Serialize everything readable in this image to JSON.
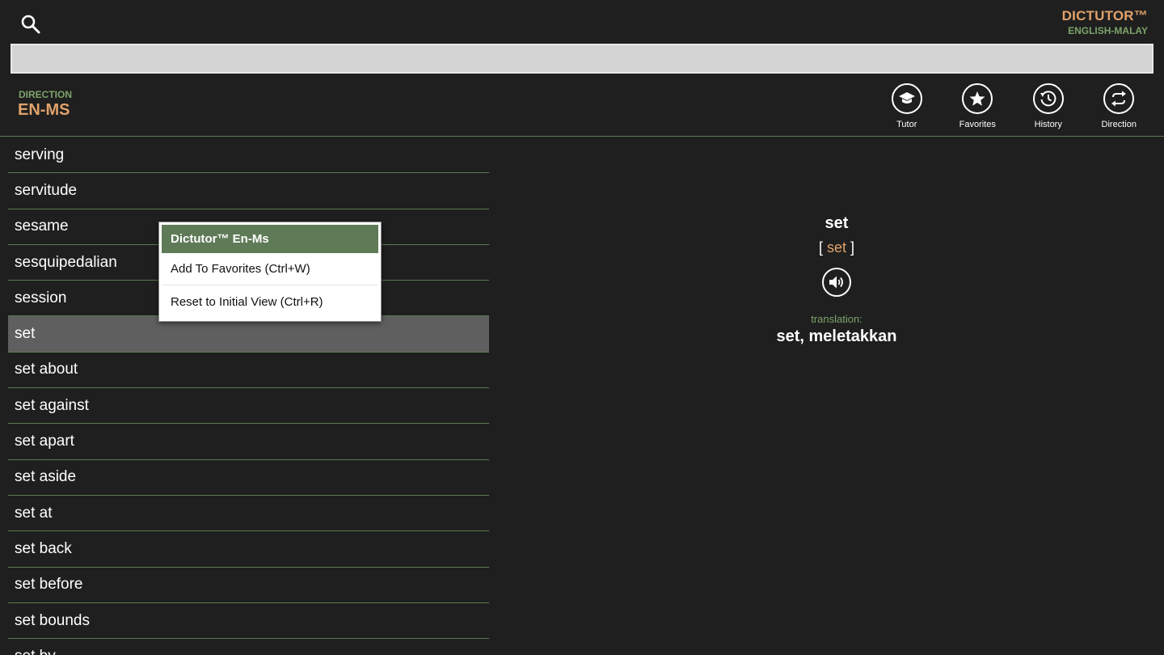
{
  "app": {
    "brand_title": "DICTUTOR™",
    "brand_subtitle": "ENGLISH-MALAY"
  },
  "search": {
    "value": "",
    "placeholder": ""
  },
  "direction": {
    "label": "DIRECTION",
    "value": "EN-MS"
  },
  "toolbar": {
    "tutor_label": "Tutor",
    "favorites_label": "Favorites",
    "history_label": "History",
    "direction_label": "Direction"
  },
  "word_list": [
    "serving",
    "servitude",
    "sesame",
    "sesquipedalian",
    "session",
    "set",
    "set about",
    "set against",
    "set apart",
    "set aside",
    "set at",
    "set back",
    "set before",
    "set bounds",
    "set by"
  ],
  "selected_index": 5,
  "context_menu": {
    "title": "Dictutor™ En-Ms",
    "add_favorites": "Add To Favorites (Ctrl+W)",
    "reset_view": "Reset to Initial View (Ctrl+R)"
  },
  "detail": {
    "headword": "set",
    "bracket_open": "[",
    "transcription": "set",
    "bracket_close": "]",
    "translation_label": "translation:",
    "translation": "set, meletakkan"
  },
  "icons": {
    "search": "search-icon",
    "tutor": "graduation-cap-icon",
    "favorites": "star-icon",
    "history": "history-clock-icon",
    "direction": "swap-arrows-icon",
    "audio": "speaker-icon"
  },
  "colors": {
    "background": "#1f1f1f",
    "accent_orange": "#e0a26b",
    "accent_green": "#7da36a",
    "selection": "#5f5f5f",
    "menu_header": "#5f7a57"
  }
}
